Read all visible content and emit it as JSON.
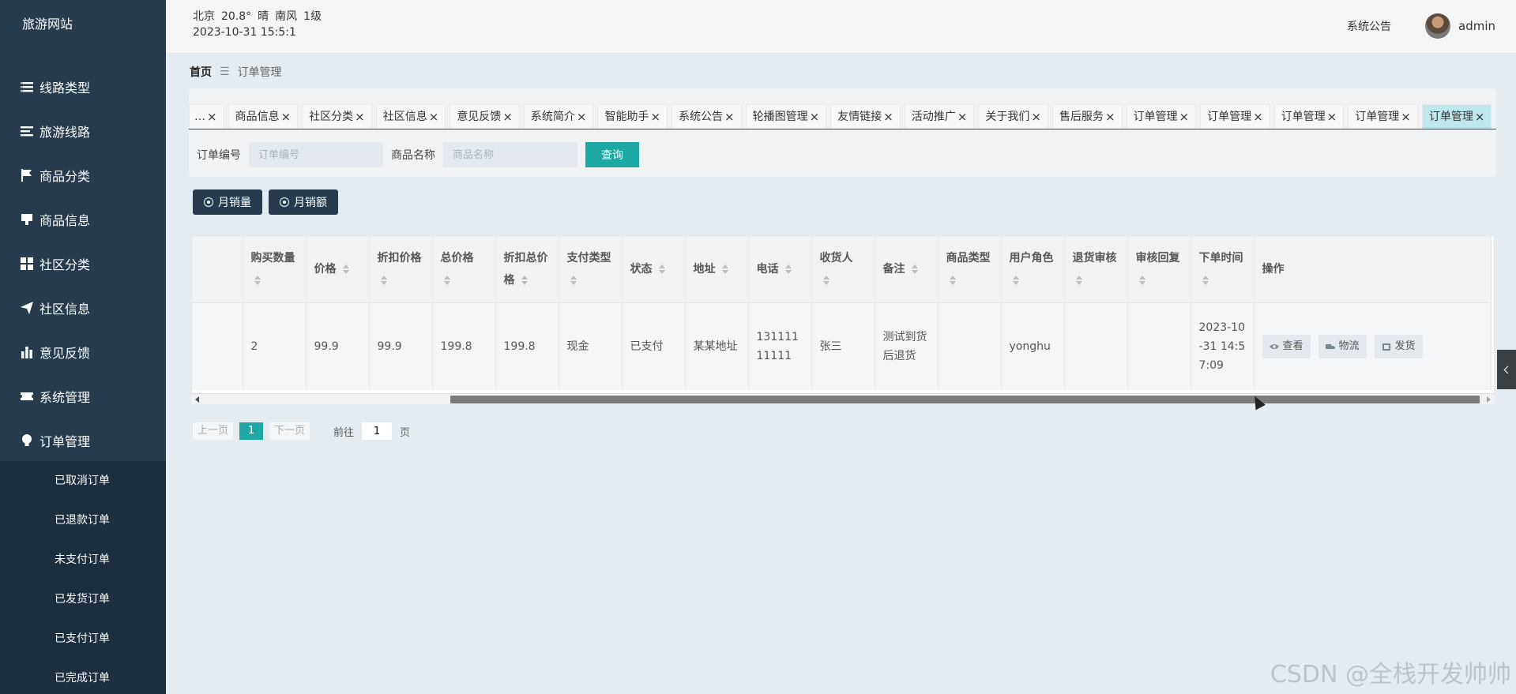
{
  "sidebar": {
    "brand": "旅游网站",
    "items": [
      {
        "label": "线路类型",
        "icon": "list-icon"
      },
      {
        "label": "旅游线路",
        "icon": "list-lines-icon"
      },
      {
        "label": "商品分类",
        "icon": "flag-icon"
      },
      {
        "label": "商品信息",
        "icon": "monitor-icon"
      },
      {
        "label": "社区分类",
        "icon": "grid-icon"
      },
      {
        "label": "社区信息",
        "icon": "paper-plane-icon"
      },
      {
        "label": "意见反馈",
        "icon": "bar-chart-icon"
      },
      {
        "label": "系统管理",
        "icon": "ticket-icon"
      },
      {
        "label": "订单管理",
        "icon": "bulb-icon"
      }
    ],
    "subitems": [
      "已取消订单",
      "已退款订单",
      "未支付订单",
      "已发货订单",
      "已支付订单",
      "已完成订单"
    ]
  },
  "header": {
    "city": "北京",
    "temp": "20.8°",
    "weather": "晴",
    "wind": "南风",
    "level": "1级",
    "datetime": "2023-10-31 15:5:1",
    "notice": "系统公告",
    "username": "admin"
  },
  "breadcrumb": {
    "home": "首页",
    "current": "订单管理"
  },
  "tabs": [
    "…",
    "商品信息",
    "社区分类",
    "社区信息",
    "意见反馈",
    "系统简介",
    "智能助手",
    "系统公告",
    "轮播图管理",
    "友情链接",
    "活动推广",
    "关于我们",
    "售后服务",
    "订单管理",
    "订单管理",
    "订单管理",
    "订单管理",
    "订单管理"
  ],
  "search": {
    "order_label": "订单编号",
    "order_placeholder": "订单编号",
    "goods_label": "商品名称",
    "goods_placeholder": "商品名称",
    "query_button": "查询"
  },
  "chart_buttons": {
    "monthly_sales": "月销量",
    "monthly_amount": "月销额"
  },
  "table": {
    "headers": [
      "",
      "购买数量",
      "价格",
      "折扣价格",
      "总价格",
      "折扣总价格",
      "支付类型",
      "状态",
      "地址",
      "电话",
      "收货人",
      "备注",
      "商品类型",
      "用户角色",
      "退货审核",
      "审核回复",
      "下单时间",
      "操作"
    ],
    "row": [
      "",
      "2",
      "99.9",
      "99.9",
      "199.8",
      "199.8",
      "现金",
      "已支付",
      "某某地址",
      "13111111111",
      "张三",
      "测试到货后退货",
      "",
      "yonghu",
      "",
      "",
      "2023-10-31 14:57:09"
    ],
    "ops": {
      "view": "查看",
      "logistics": "物流",
      "ship": "发货"
    }
  },
  "pager": {
    "prev": "上一页",
    "current": "1",
    "next": "下一页",
    "goto_label": "前往",
    "goto_value": "1",
    "page_suffix": "页"
  },
  "watermark": "CSDN @全栈开发帅帅",
  "colors": {
    "sidebar": "#263b4e",
    "accent": "#1da8a3",
    "active_tab": "#bfe8ed"
  }
}
